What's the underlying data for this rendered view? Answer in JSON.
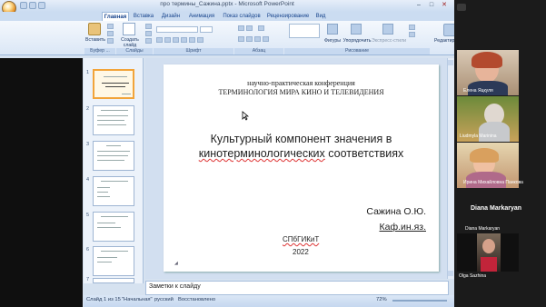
{
  "window": {
    "title": "про термины_Сажина.pptx - Microsoft PowerPoint",
    "tabs": [
      "Главная",
      "Вставка",
      "Дизайн",
      "Анимация",
      "Показ слайдов",
      "Рецензирование",
      "Вид"
    ]
  },
  "ribbon": {
    "insert_label": "Вставить",
    "new_slide_label": "Создать слайд",
    "shapes_label": "Фигуры",
    "arrange_label": "Упорядочить",
    "quick_styles_label": "Экспресс-стили",
    "edit_label": "Редактирование",
    "groups": [
      "Буфер ...",
      "Слайды",
      "Шрифт",
      "Абзац",
      "Рисование"
    ]
  },
  "slides_panel": {
    "numbers": [
      "1",
      "2",
      "3",
      "4",
      "5",
      "6",
      "7"
    ]
  },
  "slide": {
    "line1": "научно-практическая конференция",
    "line2": "ТЕРМИНОЛОГИЯ МИРА КИНО И ТЕЛЕВИДЕНИЯ",
    "title1": "Культурный компонент значения в",
    "title2a": "кинотерминологических",
    "title2b": " соответствиях",
    "author": "Сажина О.Ю.",
    "dept": "Каф.ин.яз.",
    "org": "СПбГИКиТ",
    "year": "2022"
  },
  "notes": {
    "placeholder": "Заметки к слайду"
  },
  "status": {
    "slide": "Слайд 1 из 15",
    "theme": "\"Начальная\"",
    "lang": "русский",
    "recovered": "Восстановлено",
    "zoom": "72%"
  },
  "participants": [
    {
      "name": "Елена Яцкуля"
    },
    {
      "name": "Liudmyla Marinina"
    },
    {
      "name": "Ирина Михайловна Панкова"
    },
    {
      "name": "Diana Markaryan"
    },
    {
      "name": "Olga Sazhina"
    }
  ]
}
